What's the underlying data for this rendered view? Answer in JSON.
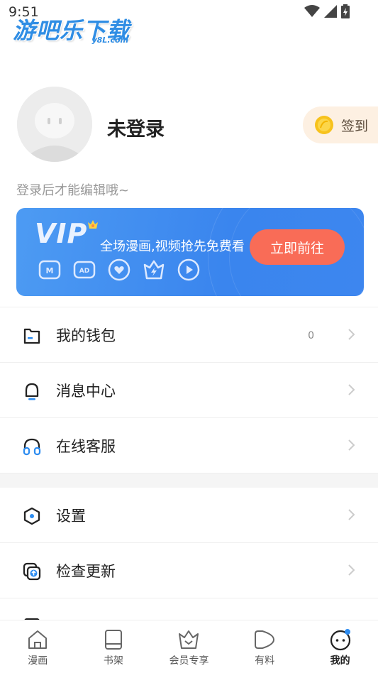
{
  "status_bar": {
    "time": "9:51"
  },
  "watermark": {
    "main": "游吧乐下载",
    "sub": "y8L.com"
  },
  "profile": {
    "name": "未登录",
    "signin_label": "签到",
    "hint": "登录后才能编辑哦~"
  },
  "vip_card": {
    "logo": "VIP",
    "slogan": "全场漫画,视频抢先免费看",
    "button": "立即前往",
    "feature_icons": [
      "manga-icon",
      "ad-free-icon",
      "heart-icon",
      "speed-icon",
      "video-play-icon"
    ]
  },
  "menu_group_1": [
    {
      "label": "我的钱包",
      "value": "0",
      "icon": "wallet-icon"
    },
    {
      "label": "消息中心",
      "icon": "bell-icon"
    },
    {
      "label": "在线客服",
      "icon": "headset-icon"
    }
  ],
  "menu_group_2": [
    {
      "label": "设置",
      "icon": "settings-hexagon-icon"
    },
    {
      "label": "检查更新",
      "icon": "update-icon"
    }
  ],
  "tabbar": {
    "tabs": [
      {
        "label": "漫画",
        "icon": "home-icon"
      },
      {
        "label": "书架",
        "icon": "bookshelf-icon"
      },
      {
        "label": "会员专享",
        "icon": "vip-crown-icon"
      },
      {
        "label": "有料",
        "icon": "play-bubble-icon"
      },
      {
        "label": "我的",
        "icon": "profile-face-icon",
        "active": true
      }
    ]
  },
  "colors": {
    "vip_blue": "#3d86ef",
    "vip_button": "#f96c57",
    "signin_bg": "#fdf0e2",
    "accent_blue": "#2d8cf0"
  }
}
